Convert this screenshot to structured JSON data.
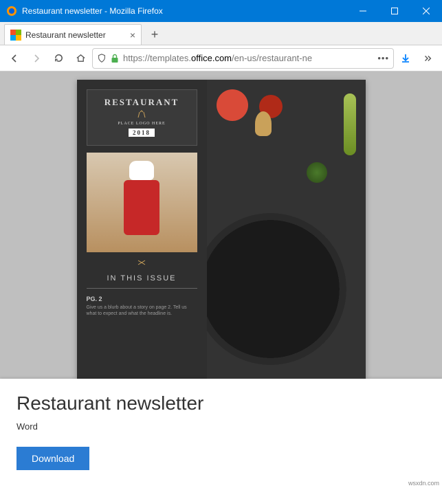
{
  "window": {
    "title": "Restaurant newsletter - Mozilla Firefox"
  },
  "tab": {
    "label": "Restaurant newsletter"
  },
  "url": {
    "prefix": "https://templates.",
    "host": "office.com",
    "suffix": "/en-us/restaurant-ne"
  },
  "template": {
    "logo_name": "RESTAURANT",
    "logo_sub": "PLACE LOGO HERE",
    "logo_year": "2018",
    "issue_heading": "IN THIS ISSUE",
    "page_ref": "PG. 2",
    "blurb": "Give us a blurb about a story on page 2. Tell us what to expect and what the headline is."
  },
  "panel": {
    "title": "Restaurant newsletter",
    "app": "Word",
    "download": "Download"
  },
  "watermark": "wsxdn.com"
}
